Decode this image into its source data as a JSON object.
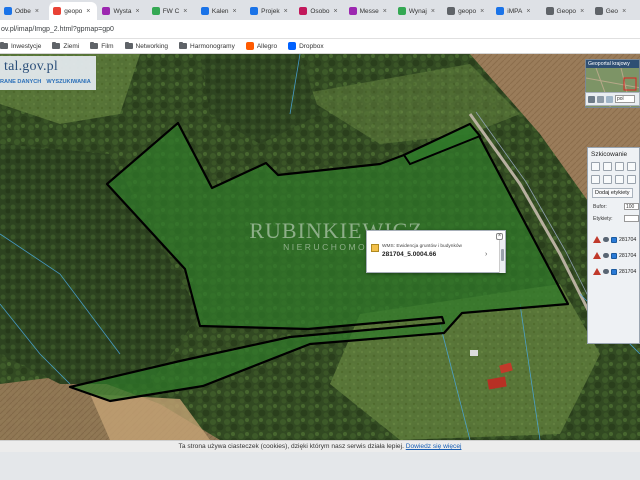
{
  "browser": {
    "tabs": [
      {
        "label": "Odbe",
        "favicon_color": "#1a73e8"
      },
      {
        "label": "geopo",
        "favicon_color": "#e94235",
        "active": true
      },
      {
        "label": "Wysta",
        "favicon_color": "#9c27b0"
      },
      {
        "label": "FW C",
        "favicon_color": "#34a853"
      },
      {
        "label": "Kalen",
        "favicon_color": "#1a73e8"
      },
      {
        "label": "Projek",
        "favicon_color": "#1a73e8"
      },
      {
        "label": "Osobo",
        "favicon_color": "#c2185b"
      },
      {
        "label": "Messe",
        "favicon_color": "#9c27b0"
      },
      {
        "label": "Wynaj",
        "favicon_color": "#34a853"
      },
      {
        "label": "geopo",
        "favicon_color": "#5f6368"
      },
      {
        "label": "iMPA",
        "favicon_color": "#1a73e8"
      },
      {
        "label": "Geopo",
        "favicon_color": "#5f6368"
      },
      {
        "label": "Geo",
        "favicon_color": "#5f6368"
      }
    ],
    "url": "ov.pl/imap/Imgp_2.html?gpmap=gp0",
    "bookmarks": [
      {
        "label": "Inwestycje",
        "type": "folder"
      },
      {
        "label": "Ziemi",
        "type": "folder"
      },
      {
        "label": "Film",
        "type": "folder"
      },
      {
        "label": "Networking",
        "type": "folder"
      },
      {
        "label": "Harmonogramy",
        "type": "folder"
      },
      {
        "label": "Allegro",
        "type": "site",
        "icon_color": "#ff5a00"
      },
      {
        "label": "Dropbox",
        "type": "site",
        "icon_color": "#0061fe"
      }
    ]
  },
  "geoportal": {
    "logo": "tal.gov.pl",
    "nav": [
      "RANE DANYCH",
      "WYSZUKIWANIA"
    ]
  },
  "watermark": {
    "title": "RUBINKIEWICZ",
    "subtitle": "NIERUCHOMOŚCI"
  },
  "popup": {
    "layer_label": "WMS: Ewidencja gruntów i budynków",
    "parcel_id": "281704_5.0004.66",
    "close_label": "×",
    "more_label": "›"
  },
  "overview": {
    "title": "Geoportal krajowy",
    "zoom_value": "pol"
  },
  "sketch_panel": {
    "title": "Szkicowanie",
    "add_labels_button": "Dodaj etykiety",
    "buffer_label": "Bufor:",
    "buffer_value": "100",
    "labels_label": "Etykiety:",
    "labels_value": "",
    "items": [
      "281704",
      "281704",
      "281704"
    ]
  },
  "cookie_notice": {
    "text": "Ta strona używa ciasteczek (cookies), dzięki którym nasz serwis działa lepiej.",
    "link": "Dowiedz się więcej"
  },
  "colors": {
    "parcel_fill": "#2f7a2a",
    "parcel_stroke": "#000000",
    "accent_blue": "#1a5fb4"
  }
}
